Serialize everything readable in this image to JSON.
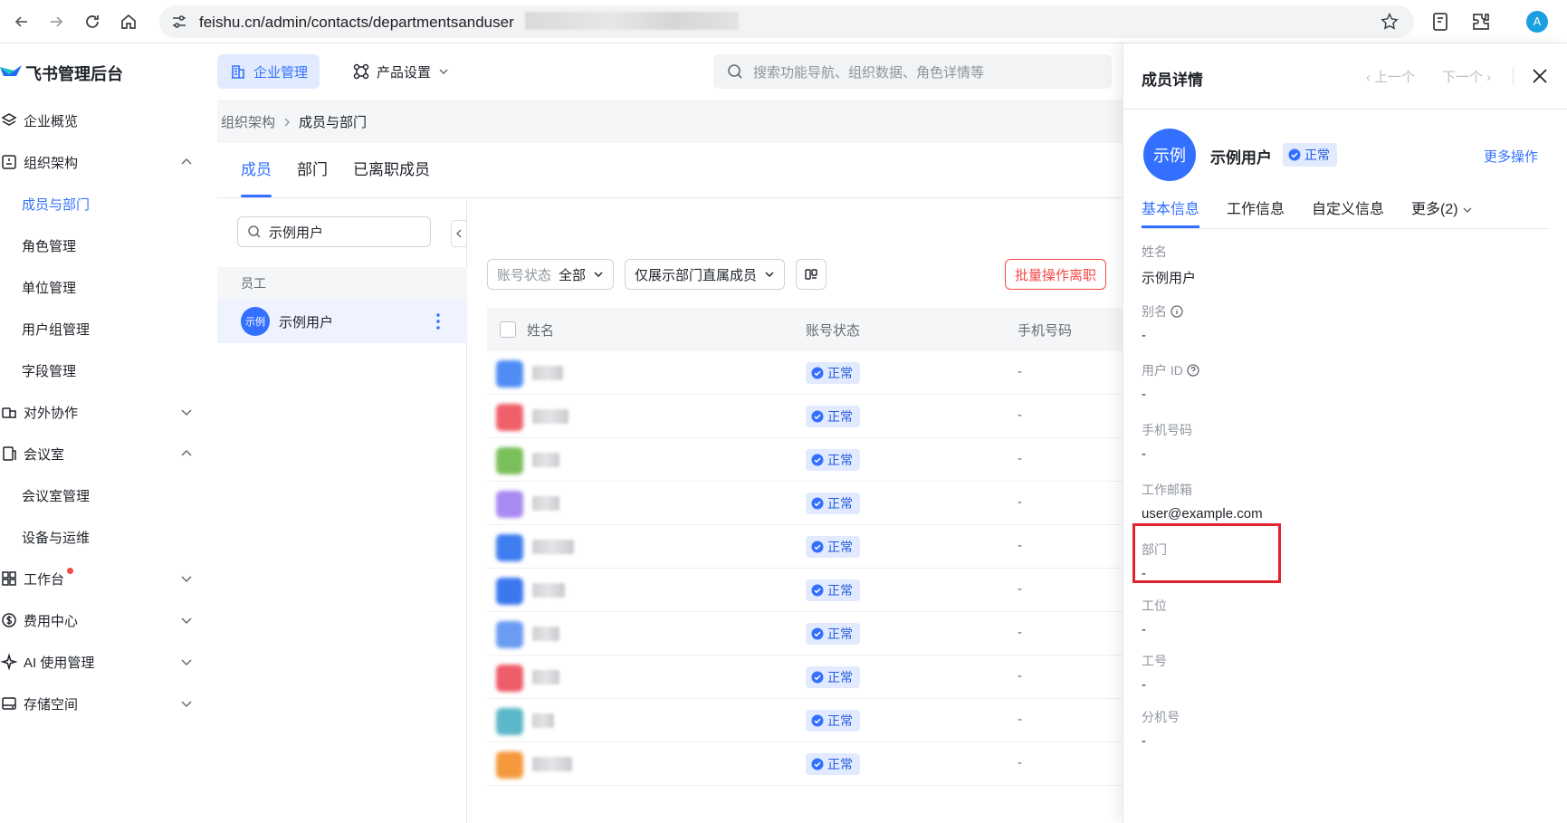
{
  "browser": {
    "url": "feishu.cn/admin/contacts/departmentsanduser",
    "profile_initial": "A"
  },
  "app": {
    "title": "飞书管理后台",
    "nav_enterprise": "企业管理",
    "nav_product": "产品设置",
    "search_placeholder": "搜索功能导航、组织数据、角色详情等"
  },
  "sidebar": {
    "items": [
      {
        "label": "企业概览",
        "icon": "layers-icon",
        "expandable": false
      },
      {
        "label": "组织架构",
        "icon": "org-icon",
        "expandable": true,
        "expanded": true
      },
      {
        "label": "成员与部门",
        "sub": true,
        "active": true
      },
      {
        "label": "角色管理",
        "sub": true
      },
      {
        "label": "单位管理",
        "sub": true
      },
      {
        "label": "用户组管理",
        "sub": true
      },
      {
        "label": "字段管理",
        "sub": true
      },
      {
        "label": "对外协作",
        "icon": "collab-icon",
        "expandable": true,
        "expanded": false
      },
      {
        "label": "会议室",
        "icon": "meeting-room-icon",
        "expandable": true,
        "expanded": true
      },
      {
        "label": "会议室管理",
        "sub": true
      },
      {
        "label": "设备与运维",
        "sub": true
      },
      {
        "label": "工作台",
        "icon": "workbench-icon",
        "expandable": true,
        "expanded": false,
        "dot": true
      },
      {
        "label": "费用中心",
        "icon": "dollar-icon",
        "expandable": true,
        "expanded": false
      },
      {
        "label": "AI 使用管理",
        "icon": "ai-sparkle-icon",
        "expandable": true,
        "expanded": false
      },
      {
        "label": "存储空间",
        "icon": "storage-icon",
        "expandable": true,
        "expanded": false
      }
    ]
  },
  "breadcrumb": {
    "parent": "组织架构",
    "current": "成员与部门"
  },
  "tabs": [
    {
      "label": "成员",
      "active": true
    },
    {
      "label": "部门",
      "active": false
    },
    {
      "label": "已离职成员",
      "active": false
    }
  ],
  "left_panel": {
    "search_value": "示例用户",
    "section_title": "员工",
    "result_name": "示例用户",
    "result_avatar": "示例"
  },
  "filters": {
    "status_label": "账号状态",
    "status_value": "全部",
    "scope_value": "仅展示部门直属成员",
    "batch_label": "批量操作离职"
  },
  "table": {
    "headers": {
      "name": "姓名",
      "status": "账号状态",
      "phone": "手机号码"
    },
    "status_text": "正常",
    "empty_text": "-",
    "rows": [
      {
        "avatar_color": "#4f8df5",
        "status": "正常",
        "phone": "-"
      },
      {
        "avatar_color": "#f0606a",
        "status": "正常",
        "phone": "-"
      },
      {
        "avatar_color": "#7bbf5a",
        "status": "正常",
        "phone": "-"
      },
      {
        "avatar_color": "#a98af2",
        "status": "正常",
        "phone": "-"
      },
      {
        "avatar_color": "#3f7ef0",
        "status": "正常",
        "phone": "-"
      },
      {
        "avatar_color": "#3a78ee",
        "status": "正常",
        "phone": "-"
      },
      {
        "avatar_color": "#6a9cf2",
        "status": "正常",
        "phone": "-"
      },
      {
        "avatar_color": "#ee5d6a",
        "status": "正常",
        "phone": "-"
      },
      {
        "avatar_color": "#5bb8c8",
        "status": "正常",
        "phone": "-"
      },
      {
        "avatar_color": "#f59a3c",
        "status": "正常",
        "phone": "-"
      }
    ]
  },
  "drawer": {
    "title": "成员详情",
    "prev": "上一个",
    "next": "下一个",
    "avatar": "示例",
    "name": "示例用户",
    "status": "正常",
    "more_actions": "更多操作",
    "tabs": [
      "基本信息",
      "工作信息",
      "自定义信息",
      "更多(2)"
    ],
    "fields": [
      {
        "label": "姓名",
        "value": "示例用户"
      },
      {
        "label": "别名",
        "value": "-",
        "hint": "info-icon"
      },
      {
        "label": "用户 ID",
        "value": "-",
        "hint": "help-icon"
      },
      {
        "label": "手机号码",
        "value": "-"
      },
      {
        "label": "工作邮箱",
        "value": "user@example.com"
      },
      {
        "label": "部门",
        "value": "-"
      },
      {
        "label": "工位",
        "value": "-"
      },
      {
        "label": "工号",
        "value": "-"
      },
      {
        "label": "分机号",
        "value": "-"
      }
    ]
  },
  "colors": {
    "accent": "#3370ff",
    "highlight_border": "#e0232e",
    "danger": "#f54a45"
  }
}
